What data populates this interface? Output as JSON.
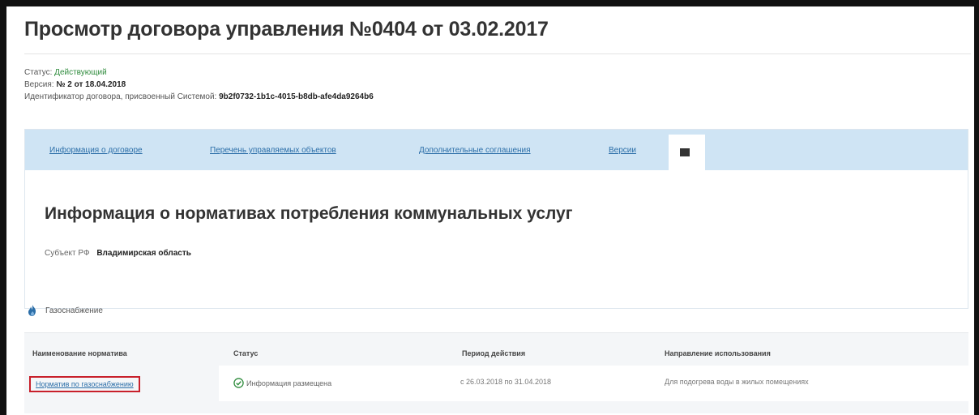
{
  "page": {
    "title": "Просмотр договора управления №0404 от 03.02.2017"
  },
  "meta": {
    "status_label": "Статус:",
    "status_value": "Действующий",
    "version_label": "Версия:",
    "version_value": "№ 2 от 18.04.2018",
    "id_label": "Идентификатор договора, присвоенный Системой:",
    "id_value": "9b2f0732-1b1c-4015-b8db-afe4da9264b6"
  },
  "tabs": [
    {
      "label": "Информация о договоре"
    },
    {
      "label": "Перечень управляемых объектов"
    },
    {
      "label": "Дополнительные соглашения"
    },
    {
      "label": "Версии"
    }
  ],
  "section": {
    "title": "Информация о нормативах потребления коммунальных услуг",
    "subject_label": "Субъект РФ",
    "subject_value": "Владимирская область"
  },
  "service": {
    "name": "Газоснабжение",
    "icon": "flame-icon"
  },
  "table": {
    "headers": [
      "Наименование норматива",
      "Статус",
      "Период действия",
      "Направление использования"
    ],
    "rows": [
      {
        "name": "Норматив по газоснабжению",
        "status": "Информация размещена",
        "period": "с 26.03.2018 по 31.04.2018",
        "usage": "Для подогрева воды в жилых помещениях"
      }
    ]
  },
  "colors": {
    "accent": "#2b6ea8",
    "tab_bar": "#cfe4f4",
    "status_green": "#2e8b3c",
    "highlight_red": "#c8202b"
  }
}
